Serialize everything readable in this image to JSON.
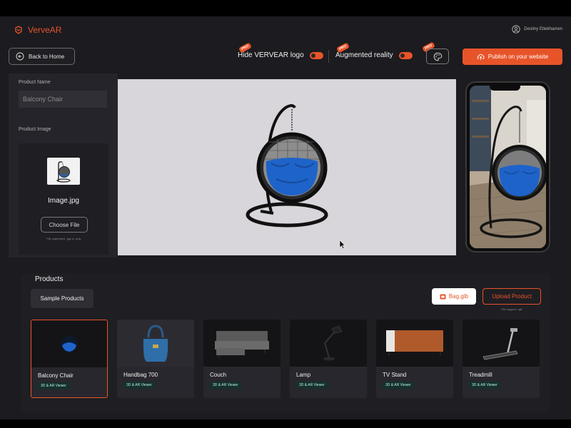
{
  "header": {
    "brand": "VerveAR",
    "user_name": "Destiny Ettekhamen"
  },
  "toolbar": {
    "back_label": "Back to Home",
    "hide_logo_label": "Hide VERVEAR logo",
    "ar_label": "Augmented reality",
    "pro_badge": "PRO",
    "publish_label": "Publish on your website",
    "accent_color": "#e8542a"
  },
  "product_form": {
    "name_label": "Product Name",
    "name_value": "Balcony Chair",
    "image_label": "Product Image",
    "image_filename": "Image.jpg",
    "choose_file_label": "Choose File",
    "supported_note": "File supported: .jpg or .png"
  },
  "products": {
    "title": "Products",
    "sample_label": "Sample Products",
    "bag_label": "Bag.glb",
    "upload_label": "Upload Product",
    "upload_note": "File support: .glb",
    "items": [
      {
        "name": "Balcony Chair",
        "badge": "3D & AR Viewer",
        "icon": "chair-icon"
      },
      {
        "name": "Handbag 700",
        "badge": "3D & AR Viewer",
        "icon": "handbag-icon"
      },
      {
        "name": "Couch",
        "badge": "3D & AR Viewer",
        "icon": "couch-icon"
      },
      {
        "name": "Lamp",
        "badge": "3D & AR Viewer",
        "icon": "lamp-icon"
      },
      {
        "name": "TV Stand",
        "badge": "3D & AR Viewer",
        "icon": "tv-stand-icon"
      },
      {
        "name": "Treadmill",
        "badge": "3D & AR Viewer",
        "icon": "treadmill-icon"
      }
    ]
  }
}
